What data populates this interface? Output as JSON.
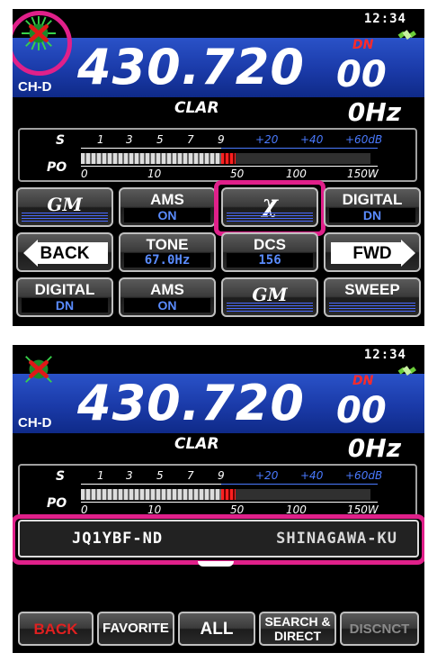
{
  "screen1": {
    "clock": "12:34",
    "freq_main": "430.720",
    "freq_sub": "00",
    "mode_badge": "DN",
    "channel": "CH-D",
    "clar_label": "CLAR",
    "clar_offset": "0Hz",
    "meter": {
      "s_label": "S",
      "po_label": "PO",
      "s_ticks": [
        "1",
        "3",
        "5",
        "7",
        "9"
      ],
      "s_plus": [
        "+20",
        "+40",
        "+60dB"
      ],
      "po_ticks": [
        "0",
        "10",
        "50",
        "100",
        "150W"
      ]
    },
    "keys": {
      "gm": "GM",
      "ams_label": "AMS",
      "ams_value": "ON",
      "digital_label": "DIGITAL",
      "digital_value": "DN",
      "back": "BACK",
      "tone_label": "TONE",
      "tone_value": "67.0Hz",
      "dcs_label": "DCS",
      "dcs_value": "156",
      "fwd": "FWD",
      "digital2_label": "DIGITAL",
      "digital2_value": "DN",
      "ams2_label": "AMS",
      "ams2_value": "ON",
      "gm2": "GM",
      "sweep": "SWEEP"
    }
  },
  "screen2": {
    "clock": "12:34",
    "freq_main": "430.720",
    "freq_sub": "00",
    "mode_badge": "DN",
    "channel": "CH-D",
    "clar_label": "CLAR",
    "clar_offset": "0Hz",
    "meter": {
      "s_label": "S",
      "po_label": "PO",
      "s_ticks": [
        "1",
        "3",
        "5",
        "7",
        "9"
      ],
      "s_plus": [
        "+20",
        "+40",
        "+60dB"
      ],
      "po_ticks": [
        "0",
        "10",
        "50",
        "100",
        "150W"
      ]
    },
    "callsign": "JQ1YBF-ND",
    "location": "SHINAGAWA-KU",
    "fkeys": {
      "back": "BACK",
      "favorite": "FAVORITE",
      "all": "ALL",
      "search_direct_1": "SEARCH &",
      "search_direct_2": "DIRECT",
      "disconnect": "DISCNCT"
    }
  },
  "colors": {
    "highlight": "#e0208a",
    "freq_band": "#1a3aa8",
    "value_blue": "#5a8cff",
    "dn_red": "#ff2a2a"
  },
  "icons": {
    "wires_x_logo": "wires-x-icon",
    "gps_satellite": "satellite-icon"
  }
}
